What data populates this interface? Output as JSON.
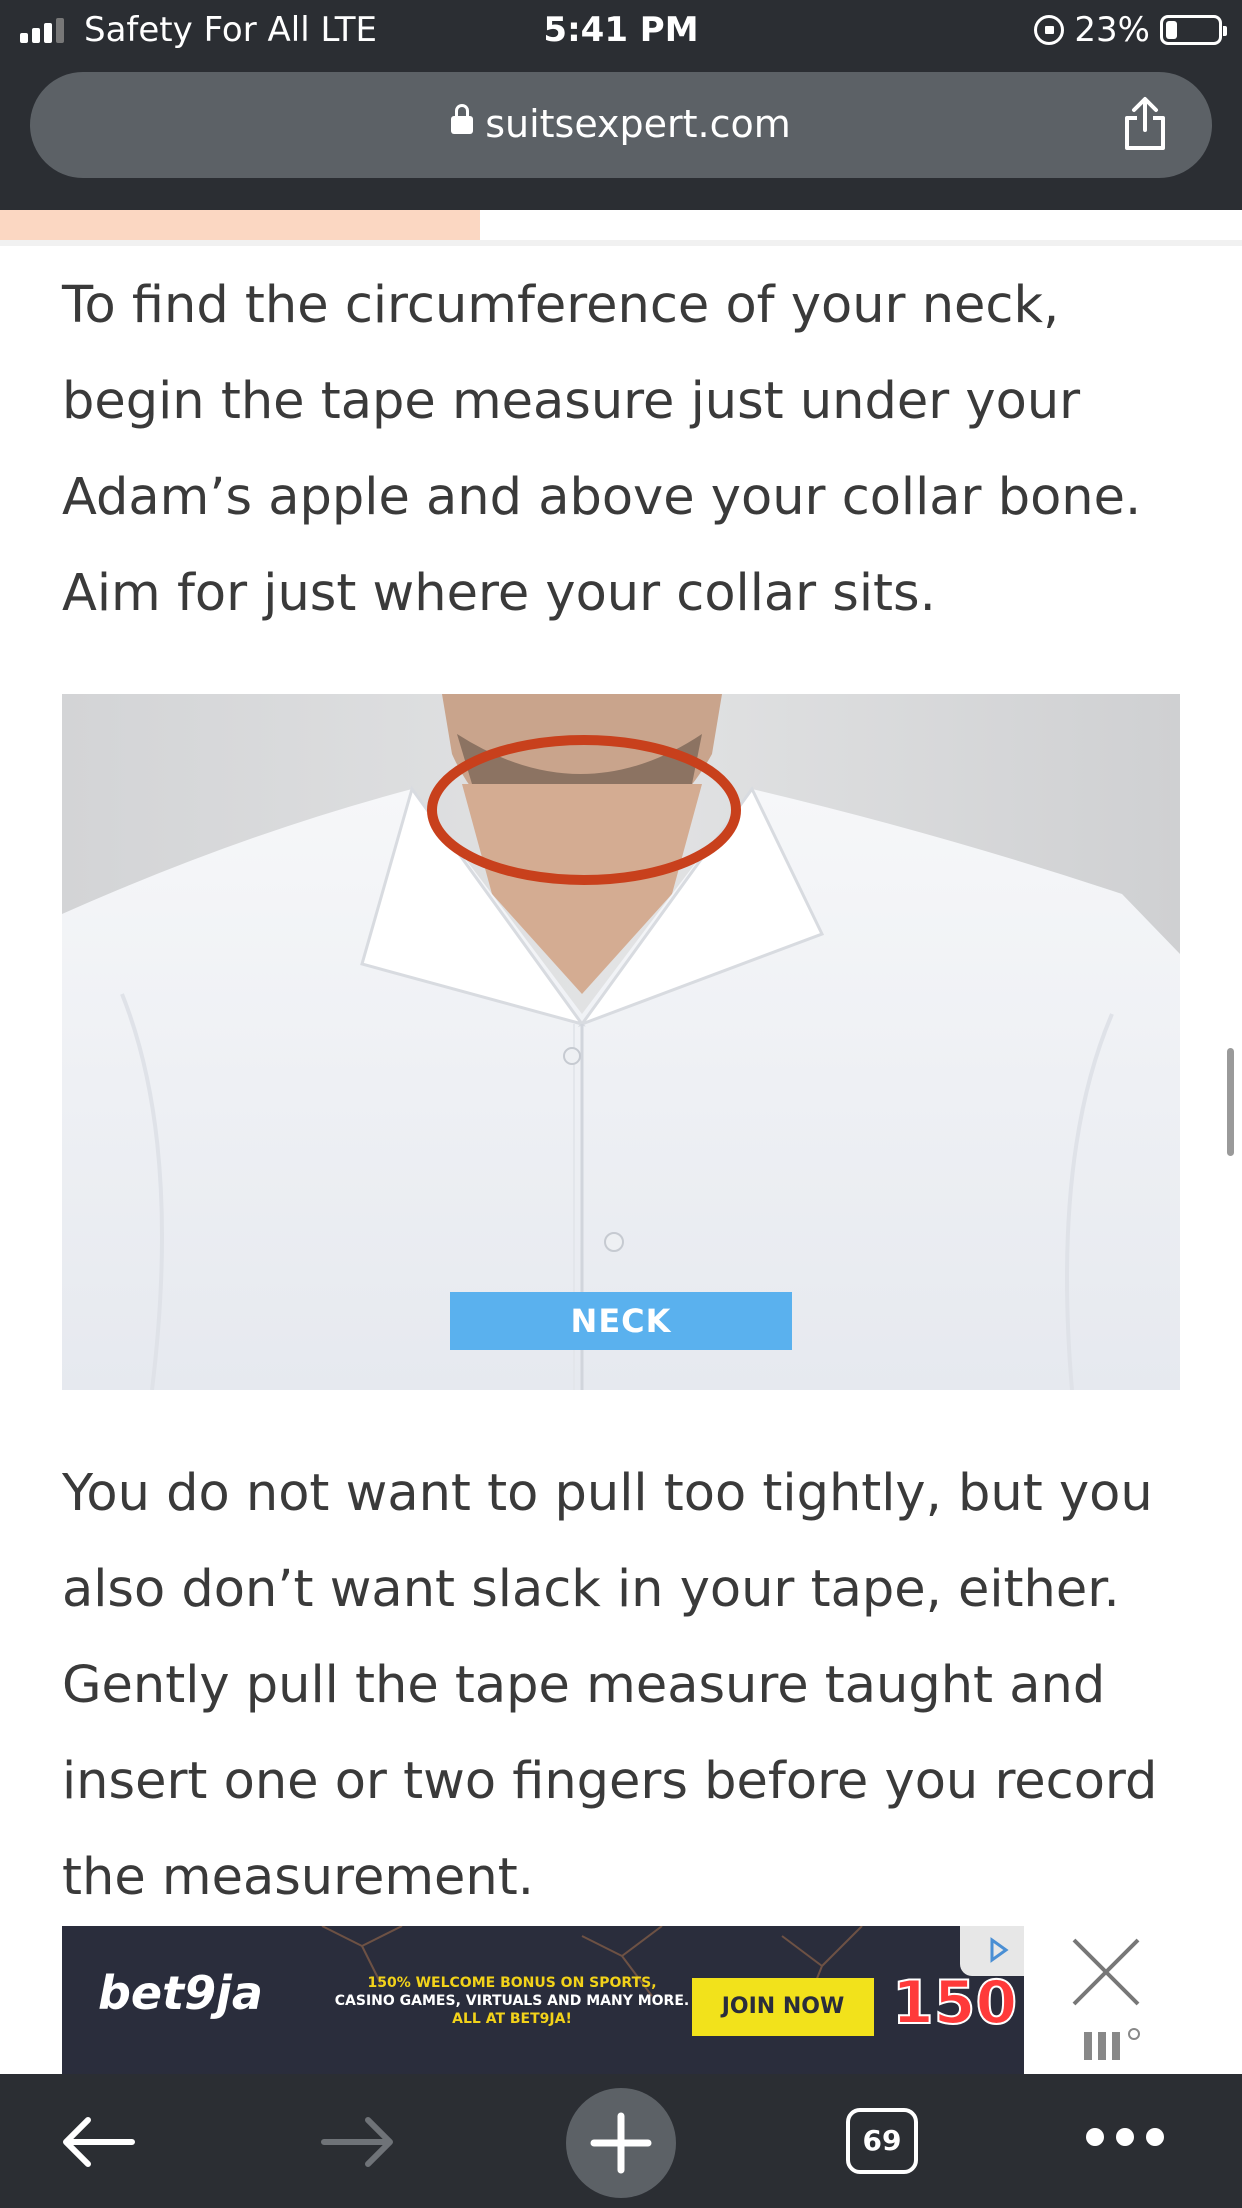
{
  "status_bar": {
    "carrier": "Safety For All  LTE",
    "time": "5:41 PM",
    "battery": "23%"
  },
  "browser": {
    "url": "suitsexpert.com",
    "tab_count": "69"
  },
  "article": {
    "paragraph_1": "To find the circumference of your neck, begin the tape measure just under your Adam’s apple and above your collar bone. Aim for just where your collar sits.",
    "image_label": "NECK",
    "paragraph_2": "You do not want to pull too tightly, but you also don’t want slack in your tape, either. Gently pull the tape measure taught and insert one or two fingers before you record the measurement."
  },
  "ad": {
    "logo": "bet9ja",
    "line_1": "150% WELCOME BONUS ON SPORTS,",
    "line_2": "CASINO GAMES, VIRTUALS AND MANY MORE.",
    "line_3": "ALL AT BET9JA!",
    "cta": "JOIN NOW",
    "amount": "150!"
  },
  "colors": {
    "accent_blue": "#5ab1ee",
    "tape_red": "#c8401c",
    "ad_yellow": "#f2e21b"
  }
}
